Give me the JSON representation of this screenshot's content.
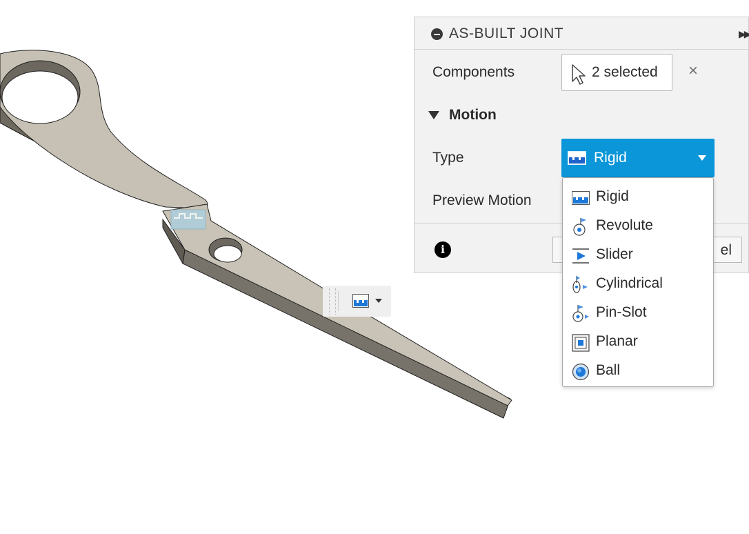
{
  "dialog": {
    "title": "AS-BUILT JOINT",
    "components_label": "Components",
    "selection_text": "2 selected",
    "clear_symbol": "×",
    "motion_section_title": "Motion",
    "type_label": "Type",
    "type_value": "Rigid",
    "preview_motion_label": "Preview Motion",
    "info_symbol": "i",
    "cancel_label_partial": "el",
    "accent_color": "#0a96d8"
  },
  "type_menu": {
    "items": [
      {
        "label": "Rigid",
        "icon": "rigid-joint-icon"
      },
      {
        "label": "Revolute",
        "icon": "revolute-joint-icon"
      },
      {
        "label": "Slider",
        "icon": "slider-joint-icon"
      },
      {
        "label": "Cylindrical",
        "icon": "cylindrical-joint-icon"
      },
      {
        "label": "Pin-Slot",
        "icon": "pin-slot-joint-icon"
      },
      {
        "label": "Planar",
        "icon": "planar-joint-icon"
      },
      {
        "label": "Ball",
        "icon": "ball-joint-icon"
      }
    ]
  },
  "canvas": {
    "model": "scissor-blade-component",
    "mini_toolbar_icon": "rigid-joint-icon"
  }
}
